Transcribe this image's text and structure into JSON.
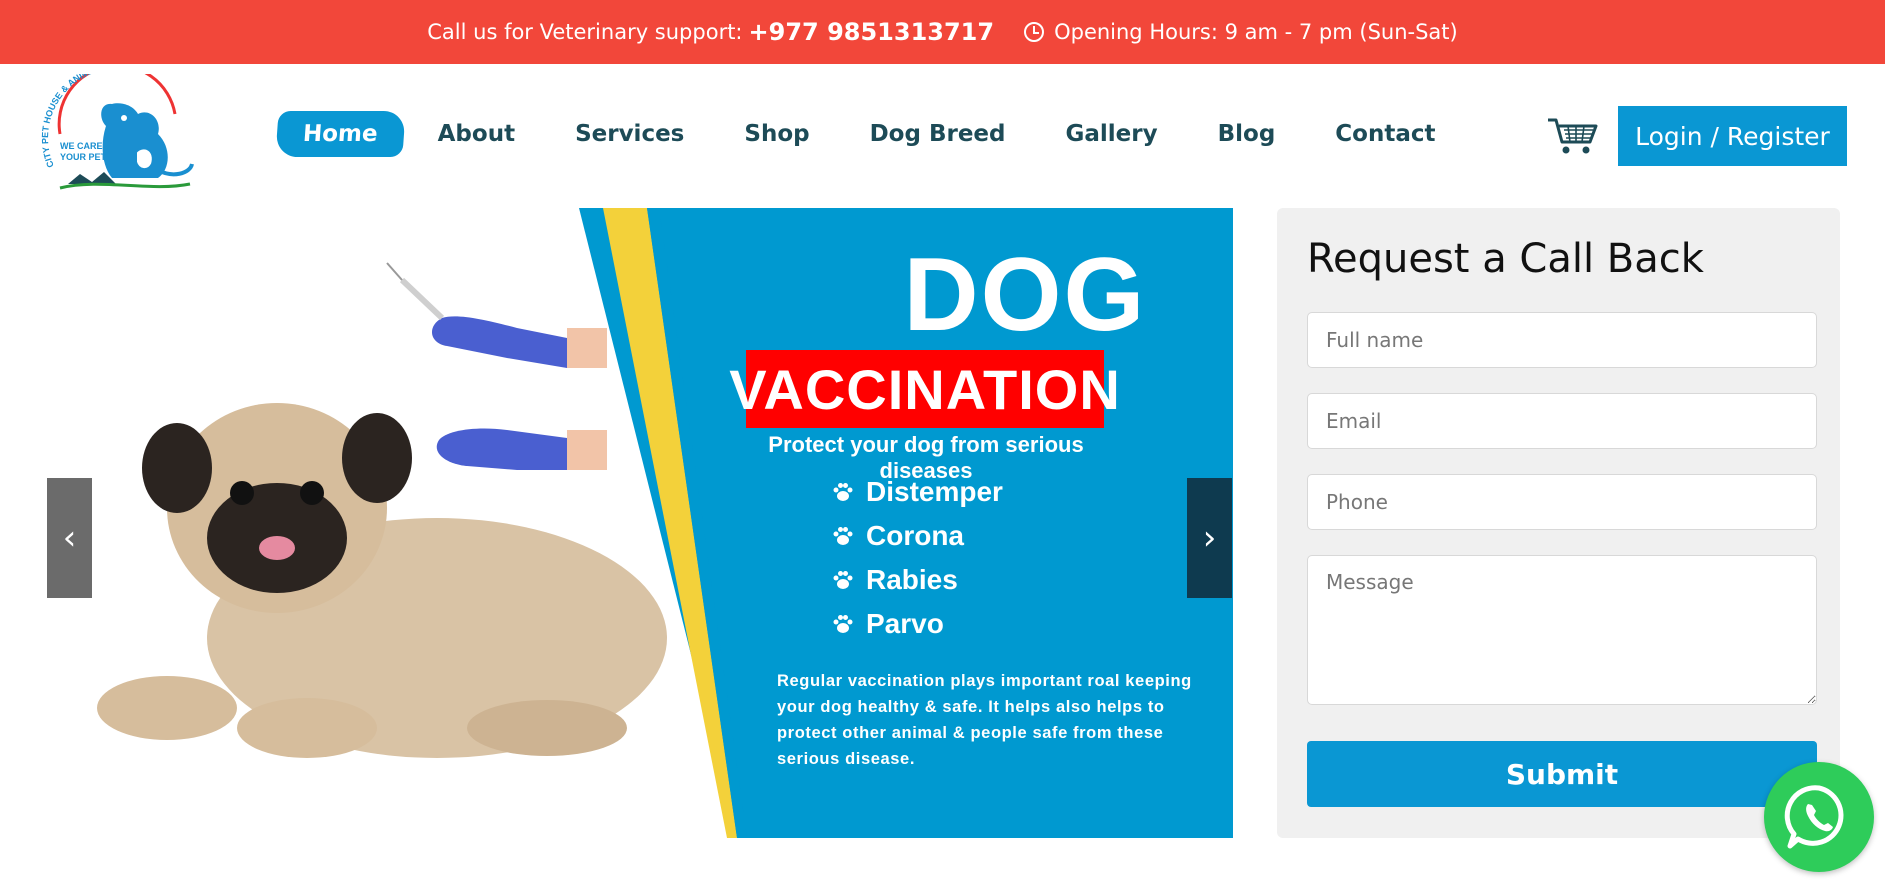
{
  "topbar": {
    "support_label": "Call us for Veterinary support:",
    "phone": "+977 9851313717",
    "hours": "Opening Hours: 9 am - 7 pm (Sun-Sat)"
  },
  "logo": {
    "clinic_name": "CITY PET HOUSE & ANIMAL CLINIC",
    "tagline_line1": "WE CARE",
    "tagline_line2": "YOUR PET"
  },
  "nav": {
    "items": [
      "Home",
      "About",
      "Services",
      "Shop",
      "Dog Breed",
      "Gallery",
      "Blog",
      "Contact"
    ],
    "active": "Home"
  },
  "header": {
    "cart_icon": "shopping-cart-icon",
    "login_label": "Login / Register"
  },
  "slider": {
    "title": "DOG",
    "banner_label": "VACCINATION",
    "subtitle": "Protect your dog from serious diseases",
    "diseases": [
      "Distemper",
      "Corona",
      "Rabies",
      "Parvo"
    ],
    "description": "Regular vaccination plays important roal keeping your dog healthy & safe. It helps also helps to protect other animal & people safe from these serious disease.",
    "prev_icon": "chevron-left-icon",
    "next_icon": "chevron-right-icon"
  },
  "callback": {
    "title": "Request a Call Back",
    "fullname_placeholder": "Full name",
    "email_placeholder": "Email",
    "phone_placeholder": "Phone",
    "message_placeholder": "Message",
    "submit_label": "Submit"
  },
  "colors": {
    "topbar": "#f2473a",
    "primary": "#0a97d3",
    "nav_text": "#1d4b57",
    "whatsapp": "#2ecc5a"
  }
}
